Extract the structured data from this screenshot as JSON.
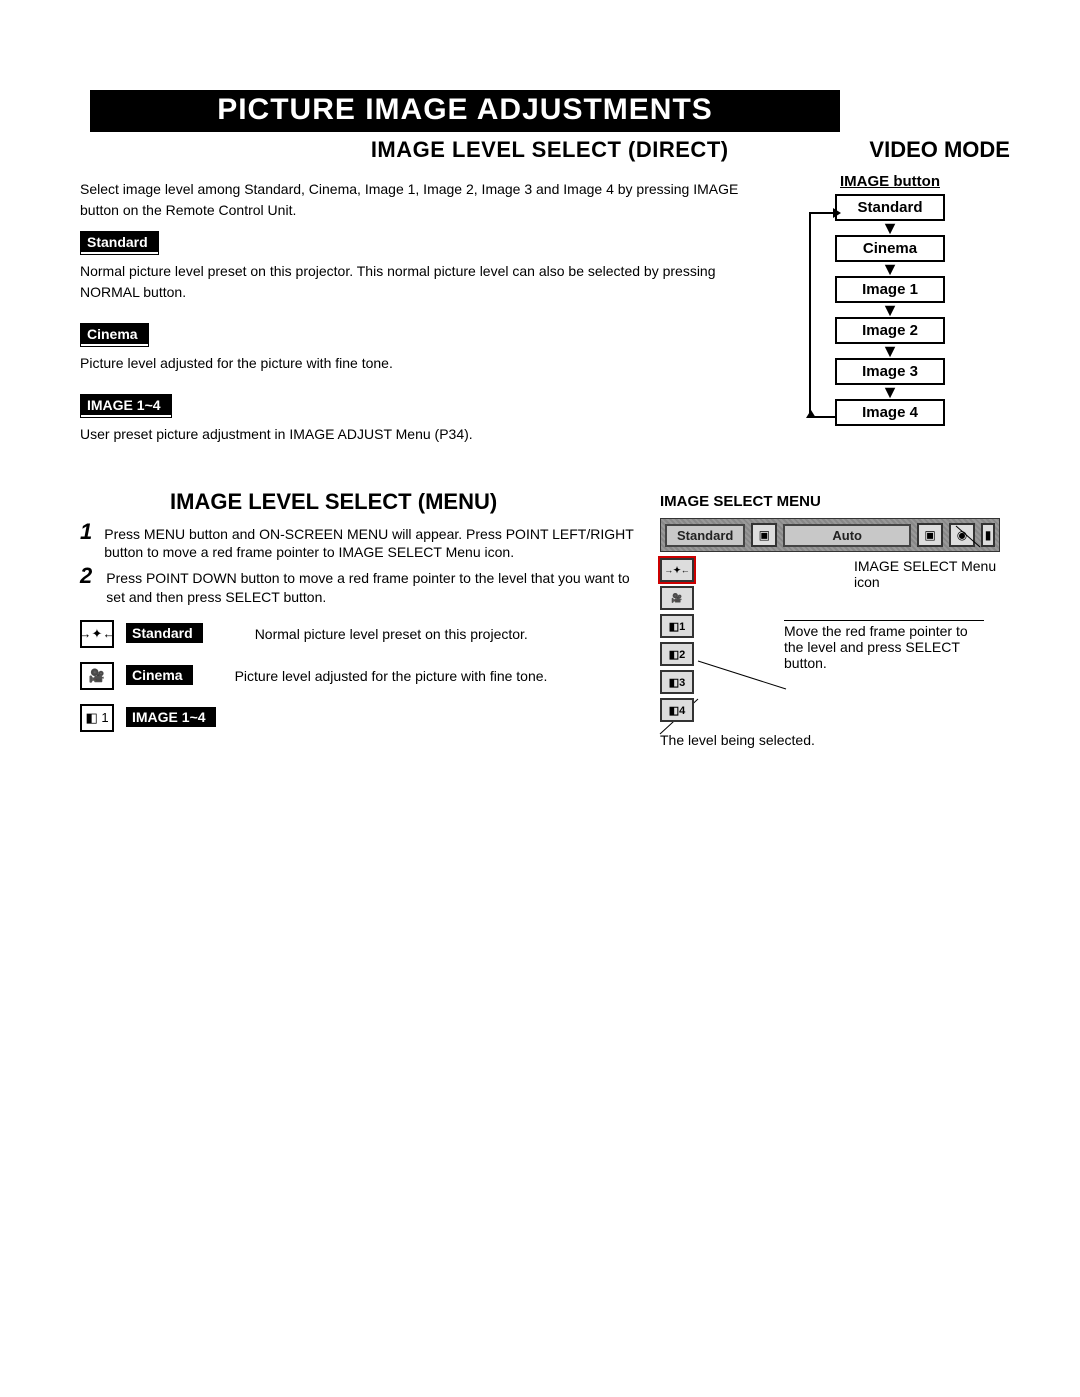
{
  "banner": "PICTURE IMAGE ADJUSTMENTS",
  "subhead": "IMAGE LEVEL SELECT (DIRECT)",
  "video_mode": "VIDEO MODE",
  "intro": "Select image level among Standard, Cinema, Image 1, Image 2, Image 3 and Image 4 by pressing IMAGE button on the Remote Control Unit.",
  "labels": {
    "standard": "Standard",
    "cinema": "Cinema",
    "image14": "IMAGE 1~4"
  },
  "desc": {
    "standard": "Normal picture level preset on this projector. This normal picture level can also be selected by pressing NORMAL button.",
    "cinema": "Picture level adjusted for the picture with fine tone.",
    "image14": "User preset picture adjustment in IMAGE ADJUST Menu (P34)."
  },
  "flow": {
    "header": "IMAGE button",
    "items": [
      "Standard",
      "Cinema",
      "Image 1",
      "Image 2",
      "Image 3",
      "Image 4"
    ]
  },
  "sect2_head": "IMAGE LEVEL SELECT (MENU)",
  "steps": {
    "1": "Press MENU button and ON-SCREEN MENU will appear. Press POINT LEFT/RIGHT button to move a red frame pointer to IMAGE SELECT Menu icon.",
    "2": "Press POINT DOWN button to move a red frame pointer to the level that you want to set and then press SELECT button."
  },
  "icons": {
    "standard_icon": "→✦←",
    "standard_label": "Standard",
    "standard_text": "Normal picture level preset on this projector.",
    "cinema_icon": "🎥",
    "cinema_label": "Cinema",
    "cinema_text": "Picture level adjusted for the picture with fine tone.",
    "image14_icon": "◧ 1",
    "image14_label": "IMAGE 1~4"
  },
  "menu": {
    "title": "IMAGE SELECT MENU",
    "chip_standard": "Standard",
    "chip_auto": "Auto",
    "note_icon": "IMAGE SELECT Menu icon",
    "note_pointer": "Move the red frame pointer to the level and press SELECT button.",
    "caption_selected": "The level being selected.",
    "cells": [
      "→✦←",
      "🎥",
      "◧1",
      "◧2",
      "◧3",
      "◧4"
    ]
  }
}
